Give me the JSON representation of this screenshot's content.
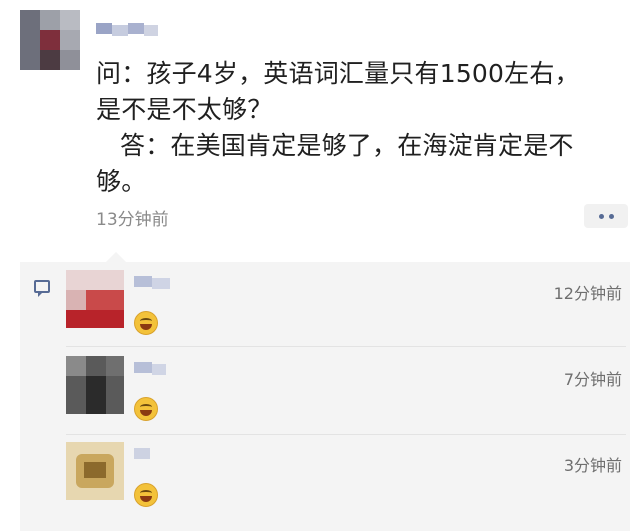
{
  "post": {
    "author_name": "博主",
    "question_line1": "问：孩子4岁，英语词汇量只有1500左右，",
    "question_line2": "是不是不太够？",
    "answer_line1": "答：在美国肯定是够了，在海淀肯定是不",
    "answer_line2": "够。",
    "time": "13分钟前",
    "more_icon": "more-dots-icon"
  },
  "comments": [
    {
      "name": "用户",
      "reaction_icon": "laugh-cry-emoji-icon",
      "time": "12分钟前"
    },
    {
      "name": "用户",
      "reaction_icon": "laugh-cry-emoji-icon",
      "time": "7分钟前"
    },
    {
      "name": "用户",
      "reaction_icon": "laugh-cry-emoji-icon",
      "time": "3分钟前"
    }
  ],
  "colors": {
    "link_blue": "#576b95",
    "comment_bg": "#f4f4f4",
    "meta_gray": "#8a8a8a"
  }
}
